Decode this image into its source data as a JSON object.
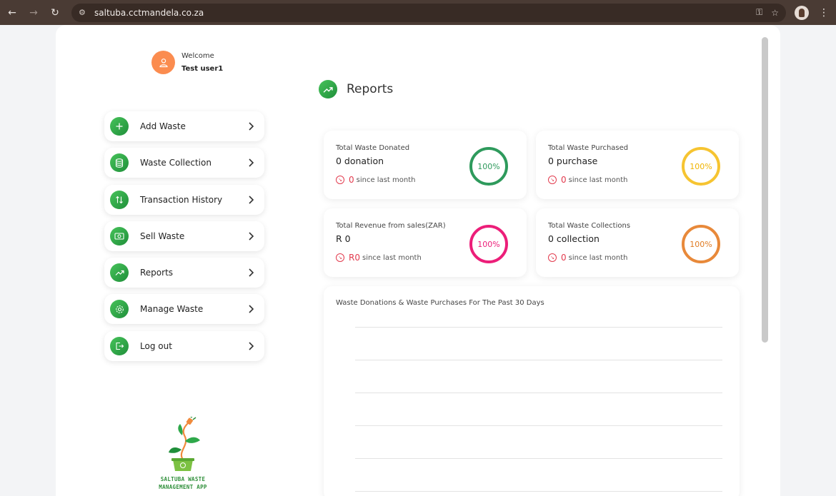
{
  "browser": {
    "url": "saltuba.cctmandela.co.za"
  },
  "user": {
    "welcome_label": "Welcome",
    "name": "Test user1"
  },
  "menu": {
    "items": [
      {
        "label": "Add Waste",
        "icon": "plus-icon"
      },
      {
        "label": "Waste Collection",
        "icon": "database-icon"
      },
      {
        "label": "Transaction History",
        "icon": "swap-arrows-icon"
      },
      {
        "label": "Sell Waste",
        "icon": "cash-icon"
      },
      {
        "label": "Reports",
        "icon": "trend-up-icon"
      },
      {
        "label": "Manage Waste",
        "icon": "gear-icon"
      },
      {
        "label": "Log out",
        "icon": "logout-icon"
      }
    ]
  },
  "logo": {
    "line1": "SALTUBA WASTE",
    "line2": "MANAGEMENT APP"
  },
  "reports": {
    "title": "Reports",
    "cards": [
      {
        "title": "Total Waste Donated",
        "value": "0 donation",
        "trend_value": "0",
        "trend_text": "since last month",
        "ring_label": "100%",
        "ring_color": "#2e9a5c"
      },
      {
        "title": "Total Waste Purchased",
        "value": "0 purchase",
        "trend_value": "0",
        "trend_text": "since last month",
        "ring_label": "100%",
        "ring_color": "#f6c431"
      },
      {
        "title": "Total Revenue from sales(ZAR)",
        "value": "R 0",
        "trend_value": "R0",
        "trend_text": "since last month",
        "ring_label": "100%",
        "ring_color": "#ec1e79"
      },
      {
        "title": "Total Waste Collections",
        "value": "0 collection",
        "trend_value": "0",
        "trend_text": "since last month",
        "ring_label": "100%",
        "ring_color": "#e8893a"
      }
    ],
    "chart": {
      "title": "Waste Donations & Waste Purchases For The Past 30 Days"
    }
  },
  "colors": {
    "accent_green": "#2ea84a",
    "avatar_orange": "#fb8c4f",
    "negative_red": "#e23b4e"
  },
  "chart_data": {
    "type": "line",
    "title": "Waste Donations & Waste Purchases For The Past 30 Days",
    "series": [],
    "grid": true
  }
}
